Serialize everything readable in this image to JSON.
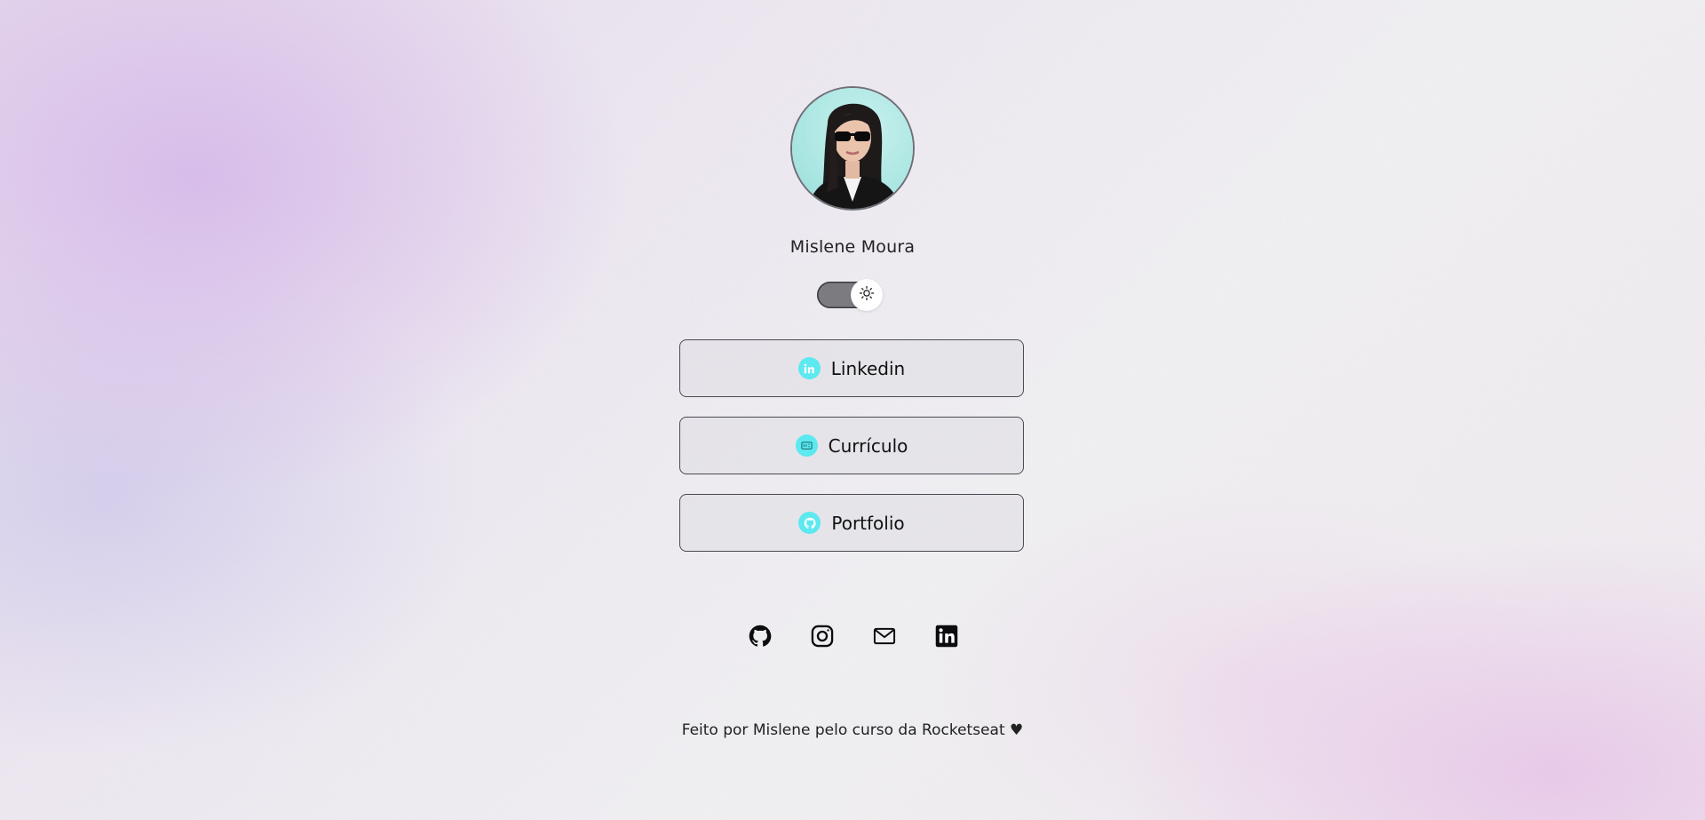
{
  "profile": {
    "name": "Mislene Moura"
  },
  "theme_toggle": {
    "icon": "sun-icon"
  },
  "links": [
    {
      "label": "Linkedin",
      "icon": "linkedin-icon"
    },
    {
      "label": "Currículo",
      "icon": "resume-icon"
    },
    {
      "label": "Portfolio",
      "icon": "github-icon"
    }
  ],
  "social": [
    {
      "icon": "github-icon"
    },
    {
      "icon": "instagram-icon"
    },
    {
      "icon": "mail-icon"
    },
    {
      "icon": "linkedin-icon"
    }
  ],
  "footer": {
    "text": "Feito por Mislene pelo curso da Rocketseat ♥"
  },
  "colors": {
    "accent": "#5ce9ef",
    "text": "#1b1b1f",
    "border": "#4a4a52"
  }
}
